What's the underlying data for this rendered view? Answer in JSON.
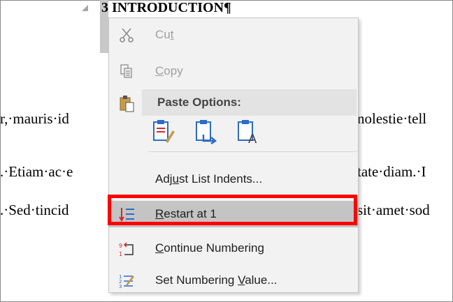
{
  "document": {
    "heading": "3 INTRODUCTION¶",
    "lines": [
      {
        "left": "r,·mauris·id",
        "right": "nolestie·tell"
      },
      {
        "left": ".·Etiam·ac·e",
        "right": "tate·diam.·I"
      },
      {
        "left": ".·Sed·tincid",
        "right": "sit·amet·sod"
      }
    ]
  },
  "menu": {
    "cut": {
      "pre": "Cu",
      "key": "t",
      "post": ""
    },
    "copy": {
      "pre": "",
      "key": "C",
      "post": "opy"
    },
    "paste_options": "Paste Options:",
    "paste_buttons": [
      "keep-source-formatting-icon",
      "merge-formatting-icon",
      "keep-text-only-icon"
    ],
    "adjust_indents": {
      "pre": "Adj",
      "key": "u",
      "post": "st List Indents..."
    },
    "restart": {
      "pre": "",
      "key": "R",
      "post": "estart at 1"
    },
    "continue": {
      "pre": "",
      "key": "C",
      "post": "ontinue Numbering"
    },
    "set_value": {
      "pre": "Set Numbering ",
      "key": "V",
      "post": "alue..."
    }
  },
  "colors": {
    "highlight_border": "#ff0000",
    "accent_blue": "#2b6cc4",
    "accent_red": "#d9262b"
  }
}
